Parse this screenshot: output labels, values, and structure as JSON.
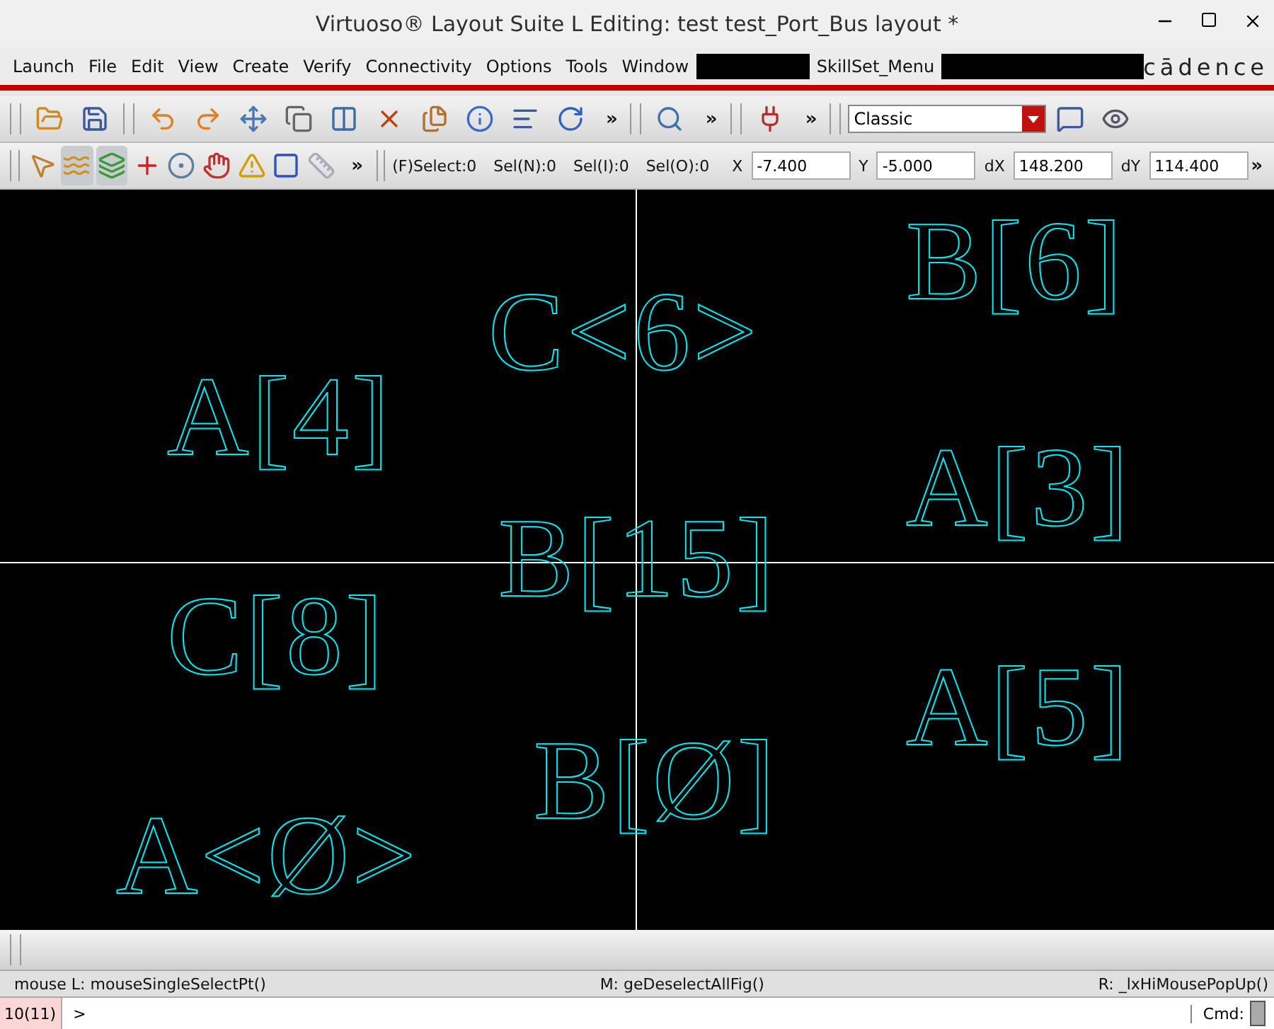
{
  "window": {
    "title": "Virtuoso® Layout Suite L Editing: test test_Port_Bus layout *"
  },
  "menu": [
    "Launch",
    "File",
    "Edit",
    "View",
    "Create",
    "Verify",
    "Connectivity",
    "Options",
    "Tools",
    "Window",
    "SkillSet_Menu"
  ],
  "logo": "cādence",
  "toolbar": {
    "overflow": [
      "»",
      "»",
      "»"
    ],
    "view_select": "Classic"
  },
  "status_toolbar": {
    "overflow": "»",
    "select_counts": [
      "(F)Select:0",
      "Sel(N):0",
      "Sel(I):0",
      "Sel(O):0"
    ],
    "coords": [
      {
        "label": "X",
        "value": "-7.400"
      },
      {
        "label": "Y",
        "value": "-5.000"
      },
      {
        "label": "dX",
        "value": "148.200"
      },
      {
        "label": "dY",
        "value": "114.400"
      }
    ],
    "end_overflow": "»"
  },
  "canvas": {
    "labels": [
      "B[6]",
      "C<6>",
      "A[4]",
      "A[3]",
      "B[15]",
      "C[8]",
      "A[5]",
      "B[Ø]",
      "A<Ø>"
    ]
  },
  "mouse_status": {
    "left": "mouse L: mouseSingleSelectPt()",
    "middle": "M: geDeselectAllFig()",
    "right": "R: _lxHiMousePopUp()"
  },
  "command_line": {
    "count": "10(11)",
    "prompt": ">",
    "cmd_label": "Cmd:"
  }
}
